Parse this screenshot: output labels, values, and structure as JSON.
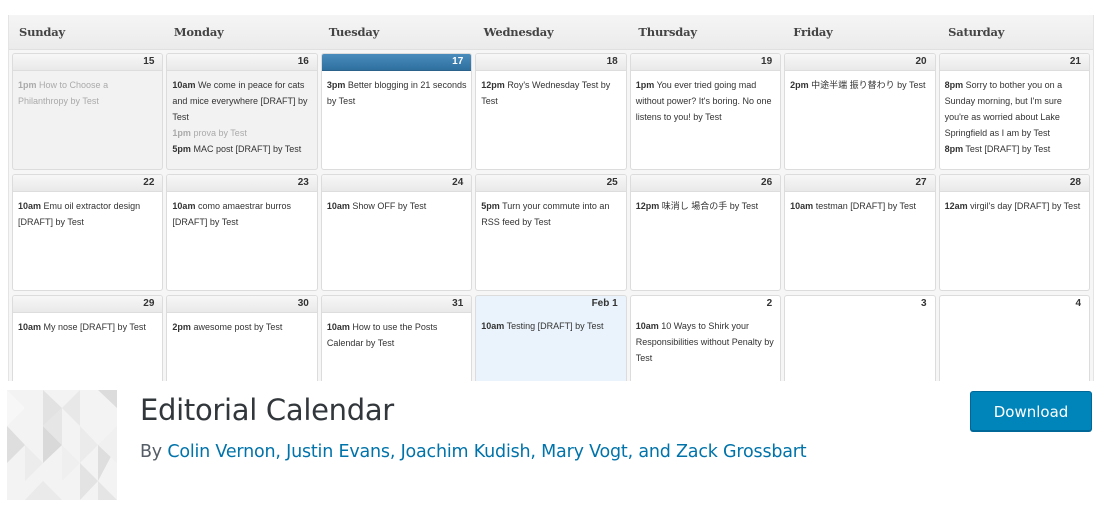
{
  "calendar": {
    "weekdays": [
      "Sunday",
      "Monday",
      "Tuesday",
      "Wednesday",
      "Thursday",
      "Friday",
      "Saturday"
    ],
    "weeks": [
      [
        {
          "label": "15",
          "state": "past",
          "posts": [
            {
              "time": "1pm",
              "title": "How to Choose a Philanthropy by Test",
              "faded": true
            }
          ]
        },
        {
          "label": "16",
          "state": "past",
          "posts": [
            {
              "time": "10am",
              "title": "We come in peace for cats and mice everywhere [DRAFT] by Test"
            },
            {
              "time": "1pm",
              "title": "prova by Test",
              "faded": true
            },
            {
              "time": "5pm",
              "title": "MAC post [DRAFT] by Test"
            }
          ]
        },
        {
          "label": "17",
          "state": "today",
          "posts": [
            {
              "time": "3pm",
              "title": "Better blogging in 21 seconds by Test"
            }
          ]
        },
        {
          "label": "18",
          "state": "",
          "posts": [
            {
              "time": "12pm",
              "title": "Roy's Wednesday Test by Test"
            }
          ]
        },
        {
          "label": "19",
          "state": "",
          "posts": [
            {
              "time": "1pm",
              "title": "You ever tried going mad without power? It's boring. No one listens to you! by Test"
            }
          ]
        },
        {
          "label": "20",
          "state": "",
          "posts": [
            {
              "time": "2pm",
              "title": "中途半端 振り替わり by Test"
            }
          ]
        },
        {
          "label": "21",
          "state": "",
          "posts": [
            {
              "time": "8pm",
              "title": "Sorry to bother you on a Sunday morning, but I'm sure you're as worried about Lake Springfield as I am by Test"
            },
            {
              "time": "8pm",
              "title": "Test [DRAFT] by Test"
            }
          ]
        }
      ],
      [
        {
          "label": "22",
          "state": "",
          "posts": [
            {
              "time": "10am",
              "title": "Emu oil extractor design [DRAFT] by Test"
            }
          ]
        },
        {
          "label": "23",
          "state": "",
          "posts": [
            {
              "time": "10am",
              "title": "como amaestrar burros [DRAFT] by Test"
            }
          ]
        },
        {
          "label": "24",
          "state": "",
          "posts": [
            {
              "time": "10am",
              "title": "Show OFF by Test"
            }
          ]
        },
        {
          "label": "25",
          "state": "",
          "posts": [
            {
              "time": "5pm",
              "title": "Turn your commute into an RSS feed by Test"
            }
          ]
        },
        {
          "label": "26",
          "state": "",
          "posts": [
            {
              "time": "12pm",
              "title": "味消し 場合の手 by Test"
            }
          ]
        },
        {
          "label": "27",
          "state": "",
          "posts": [
            {
              "time": "10am",
              "title": "testman [DRAFT] by Test"
            }
          ]
        },
        {
          "label": "28",
          "state": "",
          "posts": [
            {
              "time": "12am",
              "title": "virgil's day [DRAFT] by Test"
            }
          ]
        }
      ],
      [
        {
          "label": "29",
          "state": "",
          "posts": [
            {
              "time": "10am",
              "title": "My nose [DRAFT] by Test"
            }
          ]
        },
        {
          "label": "30",
          "state": "",
          "posts": [
            {
              "time": "2pm",
              "title": "awesome post by Test"
            }
          ]
        },
        {
          "label": "31",
          "state": "",
          "posts": [
            {
              "time": "10am",
              "title": "How to use the Posts Calendar by Test"
            }
          ]
        },
        {
          "label": "Feb 1",
          "state": "next-month",
          "posts": [
            {
              "time": "10am",
              "title": "Testing [DRAFT] by Test"
            }
          ]
        },
        {
          "label": "2",
          "state": "plain",
          "posts": [
            {
              "time": "10am",
              "title": "10 Ways to Shirk your Responsibilities without Penalty by Test"
            }
          ]
        },
        {
          "label": "3",
          "state": "plain",
          "posts": []
        },
        {
          "label": "4",
          "state": "plain",
          "posts": []
        }
      ]
    ]
  },
  "plugin": {
    "icon": "geometric-pattern-icon",
    "title": "Editorial Calendar",
    "by_prefix": "By ",
    "authors": [
      "Colin Vernon",
      "Justin Evans",
      "Joachim Kudish",
      "Mary Vogt",
      "Zack Grossbart"
    ],
    "separators": [
      ", ",
      ", ",
      ", ",
      ", and "
    ],
    "download_label": "Download"
  },
  "colors": {
    "accent": "#0085ba",
    "link": "#0073aa",
    "today_header": "#3a7eaf",
    "next_month_bg": "#eaf3fb"
  }
}
